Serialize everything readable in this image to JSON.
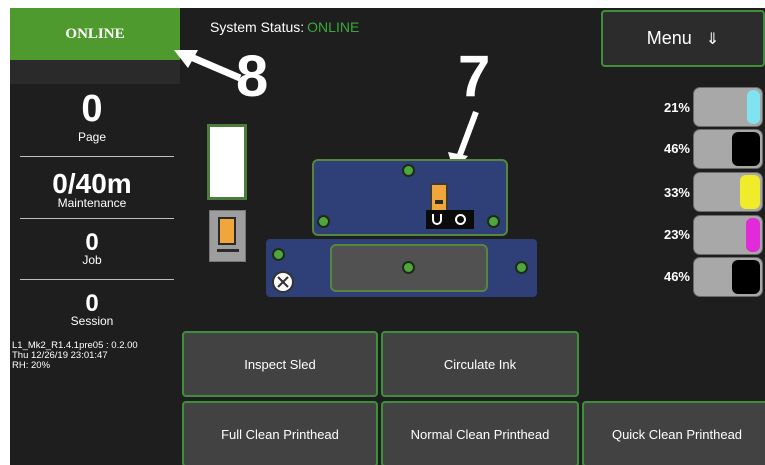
{
  "sidebar": {
    "online_button": "ONLINE",
    "counters": [
      {
        "value": "0",
        "label": "Page"
      },
      {
        "value": "0/40m",
        "label": "Maintenance"
      },
      {
        "value": "0",
        "label": "Job"
      },
      {
        "value": "0",
        "label": "Session"
      }
    ],
    "version_lines": [
      "L1_Mk2_R1.4.1pre05 : 0.2.00",
      "Thu 12/26/19 23:01:47",
      "RH: 20%"
    ]
  },
  "header": {
    "status_label": "System Status:",
    "status_value": "ONLINE",
    "status_color": "#3aa83a",
    "menu_label": "Menu",
    "menu_icon": "arrow-down-icon",
    "menu_glyph": "⇓"
  },
  "annotations": [
    "8",
    "7"
  ],
  "ink_levels": [
    {
      "percent": "21%",
      "fill_fraction": 0.21,
      "color": "#7fe3f0"
    },
    {
      "percent": "46%",
      "fill_fraction": 0.46,
      "color": "#000000"
    },
    {
      "percent": "33%",
      "fill_fraction": 0.33,
      "color": "#f1ec2a"
    },
    {
      "percent": "23%",
      "fill_fraction": 0.23,
      "color": "#e12ad8"
    },
    {
      "percent": "46%",
      "fill_fraction": 0.46,
      "color": "#000000"
    }
  ],
  "actions": {
    "inspect_sled": "Inspect Sled",
    "circulate_ink": "Circulate Ink",
    "full_clean": "Full Clean Printhead",
    "normal_clean": "Normal Clean Printhead",
    "quick_clean": "Quick Clean Printhead"
  },
  "colors": {
    "accent_green": "#4f9a2e",
    "button_border": "#3f8f3a",
    "plate_blue": "#2f3f77",
    "background": "#1e1e1e"
  }
}
